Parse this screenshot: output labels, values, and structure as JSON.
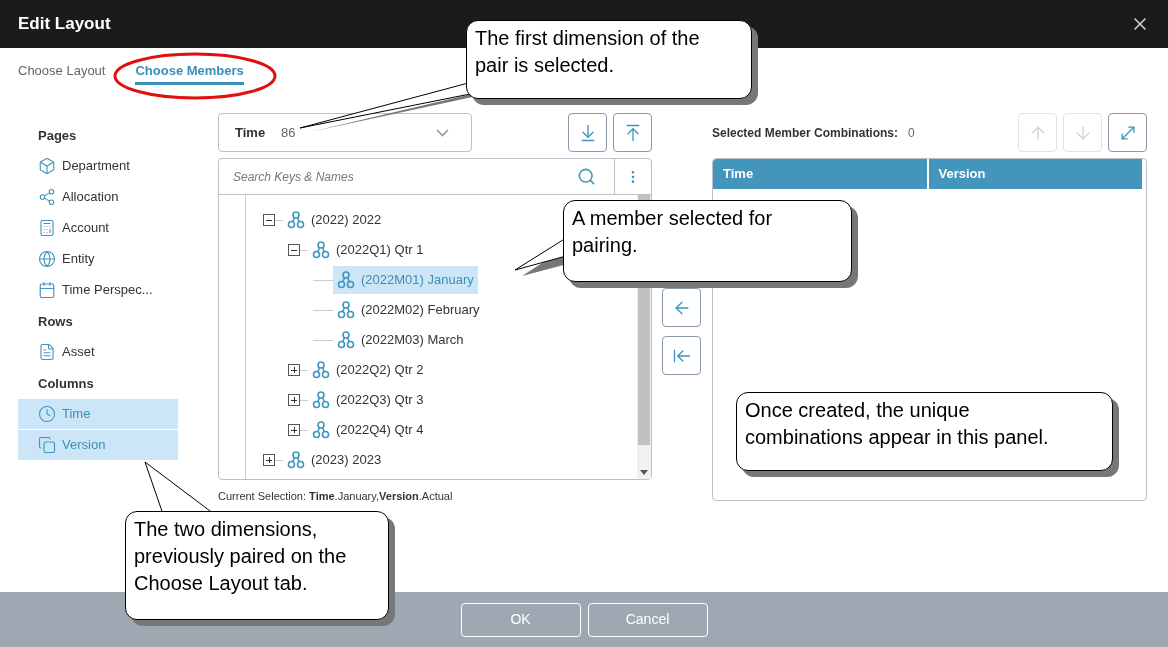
{
  "window": {
    "title": "Edit Layout"
  },
  "tabs": [
    {
      "label": "Choose Layout",
      "selected": false
    },
    {
      "label": "Choose Members",
      "selected": true
    }
  ],
  "sidebar": [
    {
      "heading": "Pages",
      "items": [
        {
          "label": "Department",
          "selected": false
        },
        {
          "label": "Allocation",
          "selected": false
        },
        {
          "label": "Account",
          "selected": false
        },
        {
          "label": "Entity",
          "selected": false
        },
        {
          "label": "Time Perspec...",
          "selected": false
        }
      ]
    },
    {
      "heading": "Rows",
      "items": [
        {
          "label": "Asset",
          "selected": false
        }
      ]
    },
    {
      "heading": "Columns",
      "items": [
        {
          "label": "Time",
          "selected": true
        },
        {
          "label": "Version",
          "selected": true
        }
      ]
    }
  ],
  "dimension_select": {
    "label": "Time",
    "count": "86"
  },
  "search": {
    "placeholder": "Search Keys & Names"
  },
  "tree": [
    {
      "label": "(2022) 2022",
      "expanded": true,
      "selected": false,
      "children": [
        {
          "label": "(2022Q1) Qtr 1",
          "expanded": true,
          "selected": false,
          "children": [
            {
              "label": "(2022M01) January",
              "selected": true
            },
            {
              "label": "(2022M02) February",
              "selected": false
            },
            {
              "label": "(2022M03) March",
              "selected": false
            }
          ]
        },
        {
          "label": "(2022Q2) Qtr 2",
          "expanded": false,
          "selected": false
        },
        {
          "label": "(2022Q3) Qtr 3",
          "expanded": false,
          "selected": false
        },
        {
          "label": "(2022Q4) Qtr 4",
          "expanded": false,
          "selected": false
        }
      ]
    },
    {
      "label": "(2023) 2023",
      "expanded": false,
      "selected": false
    }
  ],
  "current_selection": "Current Selection: **Time**.January,**Version**.Actual",
  "combinations": {
    "label": "Selected Member Combinations:",
    "count": "0",
    "columns": [
      "Time",
      "Version"
    ]
  },
  "order_buttons": [
    {
      "disabled": true
    },
    {
      "disabled": true
    }
  ],
  "footer_buttons": [
    "OK",
    "Cancel"
  ],
  "callouts": [
    {
      "text": "The first dimension of the pair is selected."
    },
    {
      "text": "A member selected for pairing."
    },
    {
      "text": "Once created, the unique combinations appear in this panel."
    },
    {
      "text": "The two dimensions, previously paired on the Choose Layout tab."
    }
  ]
}
